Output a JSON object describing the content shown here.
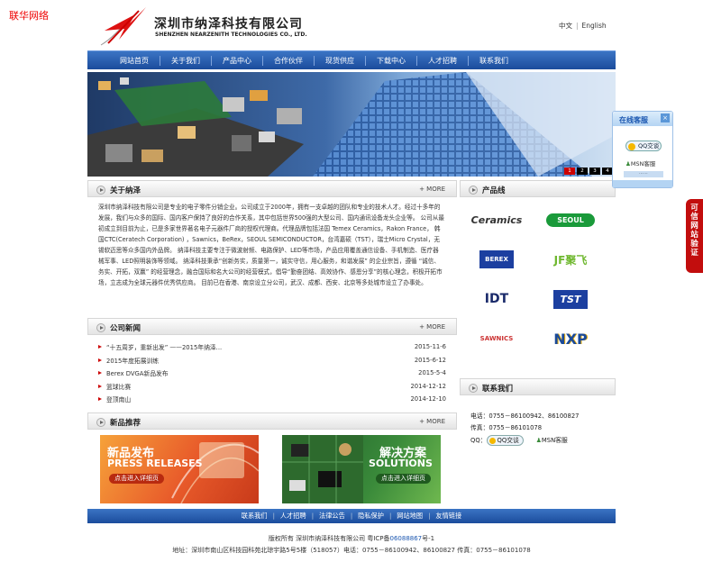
{
  "top_link": "联华网络",
  "company": {
    "name_cn": "深圳市纳泽科技有限公司",
    "name_en": "SHENZHEN NEARZENITH TECHNOLOGIES CO., LTD."
  },
  "lang": {
    "cn": "中文",
    "en": "English"
  },
  "nav": [
    "网站首页",
    "关于我们",
    "产品中心",
    "合作伙伴",
    "现货供应",
    "下载中心",
    "人才招聘",
    "联系我们"
  ],
  "banner": {
    "pages": [
      "1",
      "2",
      "3",
      "4"
    ],
    "active": 0
  },
  "about": {
    "title": "关于纳泽",
    "more": "+ MORE",
    "text": "深圳市纳泽科技有限公司是专业的电子零件分销企业。公司成立于2000年，拥有一支卓越的团队和专业的技术人才。经过十多年的发展，我们与众多的国际、国内客户保持了良好的合作关系，其中包括世界500强的大型公司、国内通讯设备龙头企业等。 公司从最初成立到目前为止，已是多家世界著名电子元器件厂商的授权代理商。代理品牌包括法国 Temex Ceramics，Rakon France， 韩国CTC(Ceratech Corporation) ，Sawnics，BeRex，SEOUL SEMICONDUCTOR，台湾嘉硕（TST），瑞士Micro Crystal，无锡软迈思等众多国内外品牌。 纳泽科技主要专注于微波射频、电路保护、LED等市场，产品应用覆盖通信设备、手机制造、医疗器械军事、LED照明装饰等领域。 纳泽科技秉承“创新务实，质量第一，诚实守信，用心服务，和谐发展” 的企业宗旨，遵循 “诚信、务实、开拓，双赢” 的经营理念，融合国际和名大公司的经营模式，倡导“勤奋团结、高效协作、感恩分享”的核心理念，积极开拓市场，立志成为全球元器件优秀供应商。 目前已在香港、南京设立分公司，武汉、成都、西安、北京等多处城市设立了办事处。"
  },
  "news": {
    "title": "公司新闻",
    "more": "+ MORE",
    "items": [
      {
        "title": "“十五周岁，重新出发” ——2015年纳泽...",
        "date": "2015-11-6"
      },
      {
        "title": "2015年度拓展训练",
        "date": "2015-6-12"
      },
      {
        "title": "Berex DVGA新品发布",
        "date": "2015-5-4"
      },
      {
        "title": "篮球比赛",
        "date": "2014-12-12"
      },
      {
        "title": "登顶南山",
        "date": "2014-12-10"
      }
    ]
  },
  "products": {
    "title": "新品推荐",
    "more": "+ MORE",
    "promo1": {
      "cn": "新品发布",
      "en": "PRESS RELEASES",
      "button": "点击进入详细页"
    },
    "promo2": {
      "cn": "解决方案",
      "en": "SOLUTIONS",
      "button": "点击进入详细页"
    }
  },
  "product_line": {
    "title": "产品线",
    "brands": [
      "Ceramics",
      "SEOUL",
      "BEREX",
      "JF聚飞",
      "IDT",
      "TST",
      "SAWNICS",
      "NXP"
    ]
  },
  "contact": {
    "title": "联系我们",
    "phone_label": "电话：",
    "phone": "0755－86100942、86100827",
    "fax_label": "传真：",
    "fax": "0755－86101078",
    "qq_label": "QQ：",
    "qq_button": "QQ交谈",
    "msn": "MSN客服"
  },
  "float_service": {
    "title": "在线客服",
    "close": "×",
    "qq": "QQ交谈",
    "msn": "MSN客服",
    "bar": "⋯⋯"
  },
  "side_tab": [
    "可",
    "信",
    "网",
    "站",
    "验",
    "证"
  ],
  "footer_nav": [
    "联系我们",
    "人才招聘",
    "法律公告",
    "隐私保护",
    "网站地图",
    "友情链接"
  ],
  "footer": {
    "copyright": "版权所有  深圳市纳泽科技有限公司  粤ICP备",
    "icp": "06088867",
    "icp_suffix": "号-1",
    "address": "地址：深圳市南山区科技园科苑北琼宇路5号5楼（518057）电话：0755－86100942、86100827  传真：0755－86101078"
  },
  "colors": {
    "nav": "#2a5fb0",
    "accent": "#cc0000",
    "link": "#1a56b0"
  }
}
